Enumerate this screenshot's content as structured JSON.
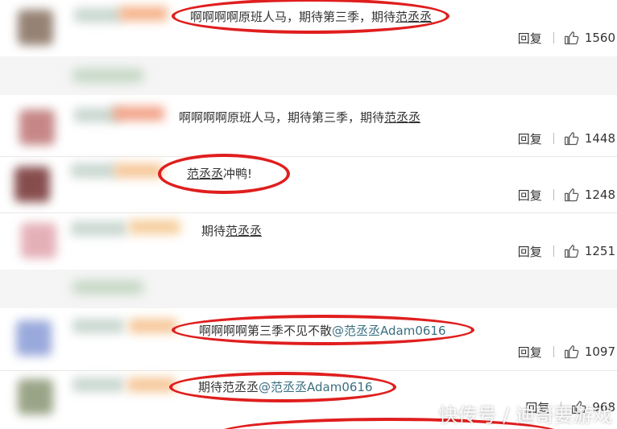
{
  "comments": [
    {
      "text": "啊啊啊啊原班人马，期待第三季，期待",
      "mention": "范丞丞",
      "reply_label": "回复",
      "likes": "1560"
    },
    {
      "text": "啊啊啊啊原班人马，期待第三季，期待",
      "mention": "范丞丞",
      "reply_label": "回复",
      "likes": "1448"
    },
    {
      "mention": "范丞丞",
      "text": "冲鸭!",
      "reply_label": "回复",
      "likes": "1248"
    },
    {
      "text": "期待",
      "mention": "范丞丞",
      "reply_label": "回复",
      "likes": "1251"
    },
    {
      "text": "啊啊啊啊第三季不见不散",
      "mention": "@范丞丞Adam0616",
      "reply_label": "回复",
      "likes": "1097"
    },
    {
      "text": "期待范丞丞",
      "mention": "@范丞丞Adam0616",
      "reply_label": "回复",
      "likes": "968"
    }
  ],
  "watermark": "快传号 / 迪哥要游戏",
  "colors": {
    "highlight_ring": "#e01e1e",
    "mention": "#3a6f7f",
    "row_alt": "#f5f5f5"
  },
  "icons": [
    "thumbs-up-icon"
  ]
}
